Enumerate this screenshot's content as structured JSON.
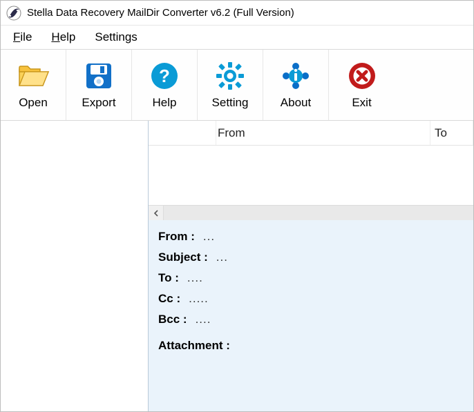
{
  "titlebar": {
    "title": "Stella Data Recovery MailDir Converter v6.2 (Full Version)"
  },
  "menubar": {
    "file_u": "F",
    "file_rest": "ile",
    "help_u": "H",
    "help_rest": "elp",
    "settings": "Settings"
  },
  "toolbar": {
    "open": "Open",
    "export": "Export",
    "help": "Help",
    "setting": "Setting",
    "about": "About",
    "exit": "Exit"
  },
  "grid": {
    "col1": "",
    "col2": "From",
    "col3": "To"
  },
  "details": {
    "from_lbl": "From :",
    "from_val": "...",
    "subject_lbl": "Subject :",
    "subject_val": "...",
    "to_lbl": "To :",
    "to_val": "....",
    "cc_lbl": "Cc :",
    "cc_val": ".....",
    "bcc_lbl": "Bcc :",
    "bcc_val": "....",
    "attach_lbl": "Attachment :"
  }
}
